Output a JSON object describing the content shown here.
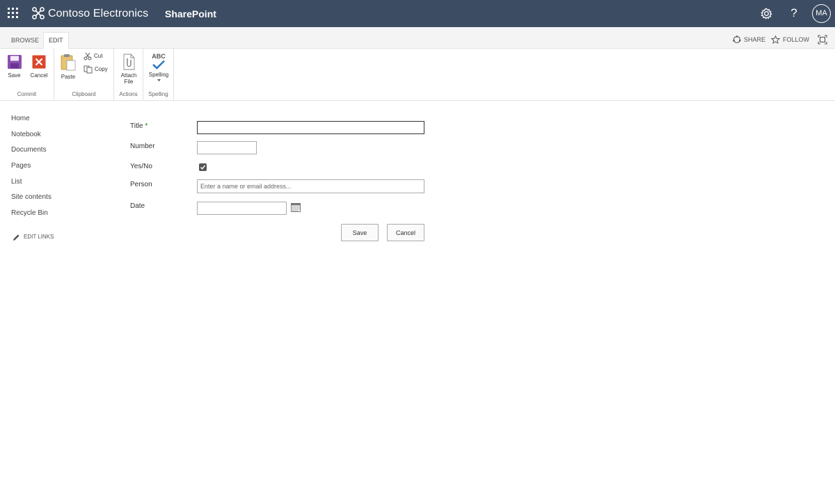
{
  "suite": {
    "brand_name": "Contoso Electronics",
    "app_name": "SharePoint",
    "help_glyph": "?",
    "avatar_initials": "MA"
  },
  "ribbon_tabs": {
    "browse": "BROWSE",
    "edit": "EDIT",
    "active": "EDIT"
  },
  "top_actions": {
    "share": "SHARE",
    "follow": "FOLLOW"
  },
  "ribbon": {
    "commit": {
      "label": "Commit",
      "save": "Save",
      "cancel": "Cancel"
    },
    "clipboard": {
      "label": "Clipboard",
      "paste": "Paste",
      "cut": "Cut",
      "copy": "Copy"
    },
    "actions": {
      "label": "Actions",
      "attach_line1": "Attach",
      "attach_line2": "File"
    },
    "spelling": {
      "label": "Spelling",
      "button": "Spelling",
      "icon_text": "ABC"
    }
  },
  "nav": {
    "items": [
      "Home",
      "Notebook",
      "Documents",
      "Pages",
      "List",
      "Site contents",
      "Recycle Bin"
    ],
    "edit_links": "EDIT LINKS"
  },
  "form": {
    "title_label": "Title",
    "required_marker": "*",
    "title_value": "",
    "number_label": "Number",
    "number_value": "",
    "yesno_label": "Yes/No",
    "yesno_checked": true,
    "person_label": "Person",
    "person_placeholder": "Enter a name or email address...",
    "date_label": "Date",
    "date_value": "",
    "save_button": "Save",
    "cancel_button": "Cancel"
  },
  "colors": {
    "suite_bar": "#3c4c62",
    "save_icon": "#8a4fb0",
    "cancel_icon": "#d9472b",
    "paste_icon": "#e8c370",
    "spelling_check": "#2b79c2",
    "required": "#107c10"
  }
}
